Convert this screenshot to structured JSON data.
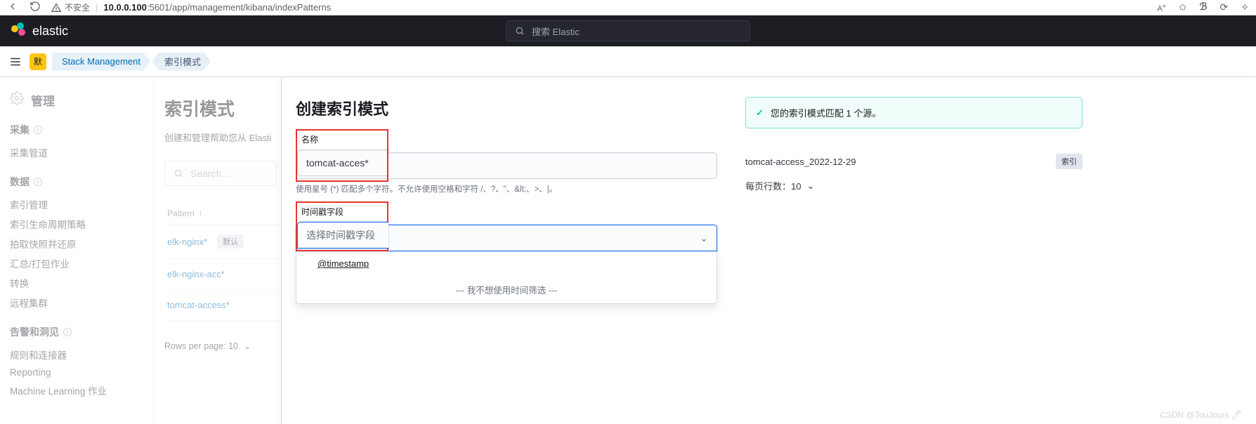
{
  "browser": {
    "insecure_label": "不安全",
    "url_host": "10.0.0.100",
    "url_port_path": ":5601/app/management/kibana/indexPatterns",
    "text_size_label": "A"
  },
  "elastic": {
    "brand": "elastic",
    "search_placeholder": "搜索 Elastic"
  },
  "breadcrumbs": {
    "badge": "默",
    "item1": "Stack Management",
    "item2": "索引模式"
  },
  "sidebar": {
    "heading": "管理",
    "sections": [
      {
        "title": "采集",
        "items": [
          "采集管道"
        ]
      },
      {
        "title": "数据",
        "items": [
          "索引管理",
          "索引生命周期策略",
          "拍取快照并还原",
          "汇总/打包作业",
          "转换",
          "远程集群"
        ]
      },
      {
        "title": "告警和洞见",
        "items": [
          "规则和连接器",
          "Reporting",
          "Machine Learning 作业"
        ]
      }
    ]
  },
  "center": {
    "title": "索引模式",
    "desc": "创建和管理帮助您从 Elasti",
    "search_placeholder": "Search...",
    "pattern_header": "Pattern",
    "patterns": [
      {
        "name": "elk-nginx*",
        "default": true
      },
      {
        "name": "elk-nginx-acc*",
        "default": false
      },
      {
        "name": "tomcat-access*",
        "default": false
      }
    ],
    "default_label": "默认",
    "rows_label": "Rows per page: 10"
  },
  "flyout": {
    "title": "创建索引模式",
    "name_label": "名称",
    "name_value": "tomcat-acces*",
    "name_help": "使用星号 (*) 匹配多个字符。不允许使用空格和字符 /、?、\"、&lt;、>、|。",
    "ts_label": "时间戳字段",
    "ts_placeholder": "选择时间戳字段",
    "ts_options": {
      "opt1": "@timestamp",
      "opt2": "--- 我不想使用时间筛选 ---"
    },
    "callout": "您的索引模式匹配 1 个源。",
    "match_prefix": "tomcat-acces",
    "match_suffix": "s_2022-12-29",
    "index_badge": "索引",
    "per_page": "每页行数：10"
  },
  "watermark": "CSDN @TouJours 🖊"
}
